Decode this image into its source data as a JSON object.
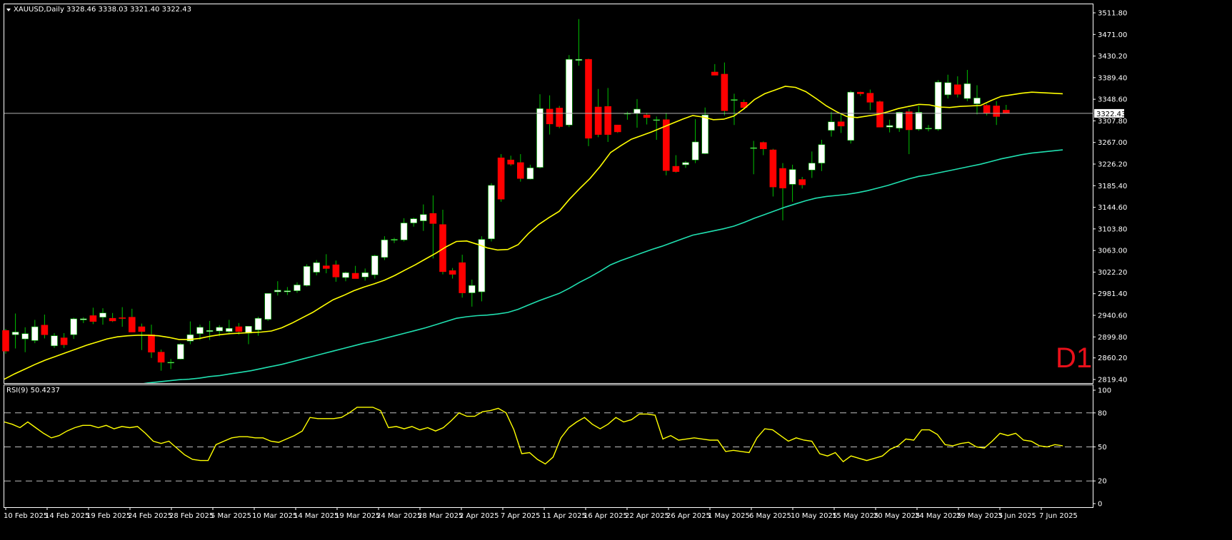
{
  "header": {
    "arrow_icon": "triangle-down-icon",
    "symbol": "XAUUSD,Daily",
    "ohlc": "3328.46 3338.03 3321.40 3322.43"
  },
  "timeframe_badge": "D1",
  "current_price_label": "3322.43",
  "colors": {
    "background": "#000000",
    "bull_body": "#ffffff",
    "bear_body": "#ff0000",
    "wick": "#00c000",
    "ma_fast": "#ffff00",
    "ma_slow": "#20e0b0",
    "rsi_line": "#ffff00",
    "axis_text": "#ffffff",
    "price_line": "#b0b0b0",
    "timeframe": "#e8101a"
  },
  "rsi_panel": {
    "label": "RSI(9) 50.4237",
    "ticks": [
      "100",
      "80",
      "50",
      "20",
      "0"
    ]
  },
  "chart_data": {
    "type": "candlestick",
    "y_ticks": [
      "3511.80",
      "3471.00",
      "3430.20",
      "3389.40",
      "3348.60",
      "3307.80",
      "3267.00",
      "3226.20",
      "3185.40",
      "3144.60",
      "3103.80",
      "3063.00",
      "3022.20",
      "2981.40",
      "2940.60",
      "2899.80",
      "2860.20",
      "2819.40"
    ],
    "ylim": [
      2819.4,
      3511.8
    ],
    "x_labels": [
      "10 Feb 2025",
      "14 Feb 2025",
      "19 Feb 2025",
      "24 Feb 2025",
      "28 Feb 2025",
      "5 Mar 2025",
      "10 Mar 2025",
      "14 Mar 2025",
      "19 Mar 2025",
      "24 Mar 2025",
      "28 Mar 2025",
      "2 Apr 2025",
      "7 Apr 2025",
      "11 Apr 2025",
      "16 Apr 2025",
      "22 Apr 2025",
      "26 Apr 2025",
      "1 May 2025",
      "6 May 2025",
      "10 May 2025",
      "15 May 2025",
      "20 May 2025",
      "24 May 2025",
      "29 May 2025",
      "3 Jun 2025",
      "7 Jun 2025"
    ],
    "candles": [
      {
        "o": 2912,
        "h": 2915,
        "l": 2868,
        "c": 2873
      },
      {
        "o": 2904,
        "h": 2944,
        "l": 2878,
        "c": 2909
      },
      {
        "o": 2896,
        "h": 2918,
        "l": 2871,
        "c": 2906
      },
      {
        "o": 2893,
        "h": 2932,
        "l": 2888,
        "c": 2919
      },
      {
        "o": 2922,
        "h": 2942,
        "l": 2897,
        "c": 2904
      },
      {
        "o": 2883,
        "h": 2907,
        "l": 2879,
        "c": 2902
      },
      {
        "o": 2898,
        "h": 2907,
        "l": 2879,
        "c": 2885
      },
      {
        "o": 2904,
        "h": 2936,
        "l": 2896,
        "c": 2934
      },
      {
        "o": 2932,
        "h": 2937,
        "l": 2926,
        "c": 2934
      },
      {
        "o": 2940,
        "h": 2955,
        "l": 2924,
        "c": 2929
      },
      {
        "o": 2937,
        "h": 2954,
        "l": 2923,
        "c": 2945
      },
      {
        "o": 2935,
        "h": 2945,
        "l": 2928,
        "c": 2930
      },
      {
        "o": 2936,
        "h": 2956,
        "l": 2919,
        "c": 2935
      },
      {
        "o": 2937,
        "h": 2953,
        "l": 2909,
        "c": 2909
      },
      {
        "o": 2919,
        "h": 2925,
        "l": 2875,
        "c": 2910
      },
      {
        "o": 2904,
        "h": 2923,
        "l": 2860,
        "c": 2871
      },
      {
        "o": 2871,
        "h": 2876,
        "l": 2836,
        "c": 2852
      },
      {
        "o": 2852,
        "h": 2858,
        "l": 2839,
        "c": 2852
      },
      {
        "o": 2858,
        "h": 2888,
        "l": 2857,
        "c": 2886
      },
      {
        "o": 2892,
        "h": 2929,
        "l": 2886,
        "c": 2904
      },
      {
        "o": 2906,
        "h": 2923,
        "l": 2894,
        "c": 2918
      },
      {
        "o": 2910,
        "h": 2930,
        "l": 2894,
        "c": 2912
      },
      {
        "o": 2911,
        "h": 2922,
        "l": 2901,
        "c": 2918
      },
      {
        "o": 2910,
        "h": 2932,
        "l": 2905,
        "c": 2916
      },
      {
        "o": 2919,
        "h": 2926,
        "l": 2904,
        "c": 2910
      },
      {
        "o": 2907,
        "h": 2919,
        "l": 2886,
        "c": 2920
      },
      {
        "o": 2913,
        "h": 2938,
        "l": 2902,
        "c": 2935
      },
      {
        "o": 2933,
        "h": 2982,
        "l": 2930,
        "c": 2982
      },
      {
        "o": 2985,
        "h": 3005,
        "l": 2978,
        "c": 2988
      },
      {
        "o": 2985,
        "h": 2994,
        "l": 2979,
        "c": 2987
      },
      {
        "o": 2987,
        "h": 3003,
        "l": 2983,
        "c": 2998
      },
      {
        "o": 2997,
        "h": 3037,
        "l": 2995,
        "c": 3033
      },
      {
        "o": 3022,
        "h": 3045,
        "l": 3016,
        "c": 3040
      },
      {
        "o": 3034,
        "h": 3056,
        "l": 3020,
        "c": 3029
      },
      {
        "o": 3036,
        "h": 3044,
        "l": 3004,
        "c": 3013
      },
      {
        "o": 3012,
        "h": 3023,
        "l": 3005,
        "c": 3021
      },
      {
        "o": 3020,
        "h": 3034,
        "l": 3010,
        "c": 3010
      },
      {
        "o": 3013,
        "h": 3029,
        "l": 3006,
        "c": 3021
      },
      {
        "o": 3017,
        "h": 3055,
        "l": 3010,
        "c": 3053
      },
      {
        "o": 3050,
        "h": 3090,
        "l": 3045,
        "c": 3083
      },
      {
        "o": 3083,
        "h": 3087,
        "l": 3077,
        "c": 3084
      },
      {
        "o": 3083,
        "h": 3124,
        "l": 3080,
        "c": 3115
      },
      {
        "o": 3115,
        "h": 3125,
        "l": 3108,
        "c": 3123
      },
      {
        "o": 3119,
        "h": 3150,
        "l": 3100,
        "c": 3131
      },
      {
        "o": 3133,
        "h": 3167,
        "l": 3048,
        "c": 3114
      },
      {
        "o": 3112,
        "h": 3140,
        "l": 3018,
        "c": 3023
      },
      {
        "o": 3025,
        "h": 3030,
        "l": 3010,
        "c": 3018
      },
      {
        "o": 3040,
        "h": 3055,
        "l": 2974,
        "c": 2983
      },
      {
        "o": 2983,
        "h": 3008,
        "l": 2957,
        "c": 2997
      },
      {
        "o": 2985,
        "h": 3090,
        "l": 2967,
        "c": 3084
      },
      {
        "o": 3085,
        "h": 3190,
        "l": 3080,
        "c": 3186
      },
      {
        "o": 3238,
        "h": 3245,
        "l": 3155,
        "c": 3160
      },
      {
        "o": 3234,
        "h": 3242,
        "l": 3223,
        "c": 3226
      },
      {
        "o": 3229,
        "h": 3245,
        "l": 3193,
        "c": 3199
      },
      {
        "o": 3198,
        "h": 3225,
        "l": 3197,
        "c": 3219
      },
      {
        "o": 3220,
        "h": 3358,
        "l": 3218,
        "c": 3331
      },
      {
        "o": 3330,
        "h": 3356,
        "l": 3282,
        "c": 3302
      },
      {
        "o": 3332,
        "h": 3336,
        "l": 3294,
        "c": 3297
      },
      {
        "o": 3300,
        "h": 3432,
        "l": 3296,
        "c": 3424
      },
      {
        "o": 3422,
        "h": 3500,
        "l": 3412,
        "c": 3424
      },
      {
        "o": 3424,
        "h": 3425,
        "l": 3260,
        "c": 3275
      },
      {
        "o": 3334,
        "h": 3368,
        "l": 3277,
        "c": 3282
      },
      {
        "o": 3335,
        "h": 3370,
        "l": 3268,
        "c": 3282
      },
      {
        "o": 3300,
        "h": 3300,
        "l": 3285,
        "c": 3287
      },
      {
        "o": 3322,
        "h": 3325,
        "l": 3310,
        "c": 3322
      },
      {
        "o": 3322,
        "h": 3349,
        "l": 3295,
        "c": 3330
      },
      {
        "o": 3319,
        "h": 3323,
        "l": 3301,
        "c": 3314
      },
      {
        "o": 3310,
        "h": 3316,
        "l": 3272,
        "c": 3310
      },
      {
        "o": 3310,
        "h": 3323,
        "l": 3205,
        "c": 3214
      },
      {
        "o": 3222,
        "h": 3243,
        "l": 3210,
        "c": 3212
      },
      {
        "o": 3225,
        "h": 3232,
        "l": 3219,
        "c": 3229
      },
      {
        "o": 3234,
        "h": 3311,
        "l": 3228,
        "c": 3268
      },
      {
        "o": 3246,
        "h": 3333,
        "l": 3245,
        "c": 3319
      },
      {
        "o": 3400,
        "h": 3415,
        "l": 3394,
        "c": 3394
      },
      {
        "o": 3396,
        "h": 3418,
        "l": 3318,
        "c": 3327
      },
      {
        "o": 3347,
        "h": 3359,
        "l": 3300,
        "c": 3348
      },
      {
        "o": 3343,
        "h": 3348,
        "l": 3330,
        "c": 3333
      },
      {
        "o": 3256,
        "h": 3270,
        "l": 3207,
        "c": 3257
      },
      {
        "o": 3267,
        "h": 3269,
        "l": 3243,
        "c": 3255
      },
      {
        "o": 3253,
        "h": 3255,
        "l": 3165,
        "c": 3183
      },
      {
        "o": 3218,
        "h": 3228,
        "l": 3120,
        "c": 3181
      },
      {
        "o": 3188,
        "h": 3225,
        "l": 3155,
        "c": 3216
      },
      {
        "o": 3197,
        "h": 3202,
        "l": 3180,
        "c": 3187
      },
      {
        "o": 3215,
        "h": 3250,
        "l": 3200,
        "c": 3228
      },
      {
        "o": 3228,
        "h": 3272,
        "l": 3213,
        "c": 3263
      },
      {
        "o": 3290,
        "h": 3325,
        "l": 3278,
        "c": 3306
      },
      {
        "o": 3306,
        "h": 3320,
        "l": 3285,
        "c": 3298
      },
      {
        "o": 3271,
        "h": 3365,
        "l": 3265,
        "c": 3362
      },
      {
        "o": 3362,
        "h": 3363,
        "l": 3355,
        "c": 3359
      },
      {
        "o": 3360,
        "h": 3367,
        "l": 3328,
        "c": 3343
      },
      {
        "o": 3344,
        "h": 3346,
        "l": 3296,
        "c": 3296
      },
      {
        "o": 3296,
        "h": 3310,
        "l": 3286,
        "c": 3299
      },
      {
        "o": 3294,
        "h": 3325,
        "l": 3287,
        "c": 3324
      },
      {
        "o": 3325,
        "h": 3330,
        "l": 3245,
        "c": 3291
      },
      {
        "o": 3292,
        "h": 3336,
        "l": 3289,
        "c": 3324
      },
      {
        "o": 3294,
        "h": 3300,
        "l": 3288,
        "c": 3294
      },
      {
        "o": 3292,
        "h": 3385,
        "l": 3289,
        "c": 3381
      },
      {
        "o": 3357,
        "h": 3395,
        "l": 3350,
        "c": 3380
      },
      {
        "o": 3376,
        "h": 3392,
        "l": 3352,
        "c": 3358
      },
      {
        "o": 3350,
        "h": 3404,
        "l": 3345,
        "c": 3378
      },
      {
        "o": 3340,
        "h": 3375,
        "l": 3320,
        "c": 3351
      },
      {
        "o": 3337,
        "h": 3340,
        "l": 3318,
        "c": 3323
      },
      {
        "o": 3336,
        "h": 3345,
        "l": 3300,
        "c": 3316
      },
      {
        "o": 3328,
        "h": 3338,
        "l": 3321,
        "c": 3322
      }
    ],
    "series": [
      {
        "values": [
          2820,
          2830,
          2839,
          2848,
          2856,
          2863,
          2870,
          2877,
          2884,
          2890,
          2896,
          2900,
          2902,
          2903,
          2903,
          2902,
          2899,
          2895,
          2895,
          2897,
          2901,
          2904,
          2906,
          2907,
          2908,
          2909,
          2911,
          2917,
          2926,
          2936,
          2946,
          2958,
          2970,
          2978,
          2987,
          2994,
          3000,
          3007,
          3016,
          3026,
          3036,
          3047,
          3058,
          3070,
          3080,
          3081,
          3075,
          3068,
          3064,
          3065,
          3074,
          3095,
          3112,
          3125,
          3137,
          3160,
          3180,
          3199,
          3222,
          3248,
          3261,
          3273,
          3280,
          3287,
          3295,
          3303,
          3311,
          3318,
          3315,
          3310,
          3311,
          3317,
          3331,
          3348,
          3359,
          3366,
          3373,
          3371,
          3363,
          3350,
          3336,
          3325,
          3316,
          3314,
          3317,
          3320,
          3325,
          3331,
          3335,
          3339,
          3338,
          3334,
          3333,
          3335,
          3336,
          3337,
          3346,
          3354,
          3357,
          3360,
          3362,
          3361,
          3360,
          3359
        ]
      },
      {
        "values": [
          2752,
          2757,
          2762,
          2767,
          2772,
          2777,
          2781,
          2785,
          2789,
          2794,
          2798,
          2802,
          2806,
          2810,
          2813,
          2815,
          2817,
          2819,
          2820,
          2822,
          2825,
          2827,
          2830,
          2833,
          2836,
          2840,
          2844,
          2848,
          2853,
          2858,
          2863,
          2868,
          2873,
          2878,
          2883,
          2888,
          2892,
          2897,
          2902,
          2907,
          2912,
          2917,
          2923,
          2929,
          2935,
          2938,
          2940,
          2941,
          2943,
          2946,
          2952,
          2960,
          2968,
          2975,
          2982,
          2992,
          3003,
          3013,
          3024,
          3036,
          3044,
          3051,
          3058,
          3065,
          3071,
          3078,
          3085,
          3092,
          3096,
          3100,
          3104,
          3109,
          3116,
          3124,
          3131,
          3138,
          3145,
          3151,
          3157,
          3162,
          3165,
          3167,
          3169,
          3172,
          3176,
          3181,
          3186,
          3192,
          3198,
          3203,
          3206,
          3210,
          3214,
          3218,
          3222,
          3226,
          3231,
          3236,
          3240,
          3244,
          3247,
          3249,
          3251,
          3253
        ]
      }
    ],
    "rsi": [
      72,
      70,
      67,
      72,
      67,
      62,
      58,
      60,
      64,
      67,
      69,
      69,
      67,
      69,
      66,
      68,
      67,
      68,
      62,
      55,
      53,
      55,
      49,
      43,
      39,
      38,
      38,
      52,
      55,
      58,
      59,
      59,
      58,
      58,
      55,
      54,
      57,
      60,
      64,
      76,
      75,
      75,
      75,
      76,
      80,
      85,
      85,
      85,
      82,
      67,
      68,
      66,
      68,
      65,
      67,
      64,
      67,
      73,
      80,
      77,
      77,
      81,
      82,
      84,
      80,
      65,
      44,
      45,
      39,
      35,
      41,
      58,
      67,
      72,
      76,
      70,
      66,
      70,
      76,
      72,
      74,
      79,
      79,
      78,
      57,
      60,
      56,
      57,
      58,
      57,
      56,
      56,
      46,
      47,
      46,
      45,
      58,
      66,
      65,
      60,
      55,
      58,
      56,
      55,
      44,
      42,
      45,
      37,
      42,
      40,
      38,
      40,
      42,
      48,
      51,
      57,
      56,
      65,
      65,
      61,
      52,
      51,
      53,
      54,
      50,
      49,
      55,
      62,
      60,
      62,
      56,
      55,
      51,
      50,
      52,
      51
    ]
  }
}
